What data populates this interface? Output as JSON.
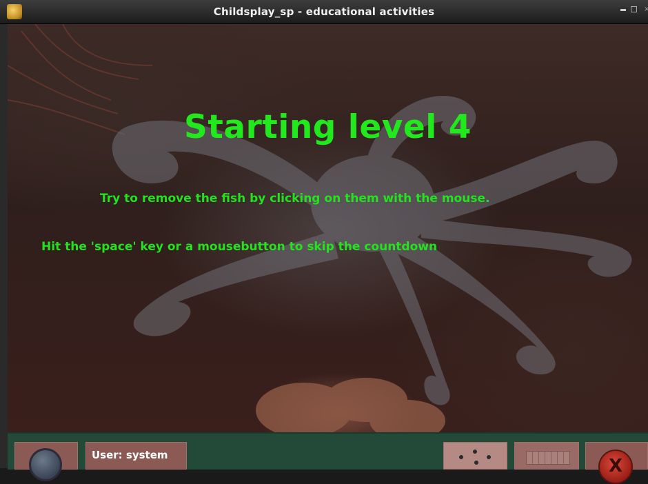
{
  "window": {
    "title": "Childsplay_sp - educational activities",
    "controls": {
      "minimize": "–",
      "maximize": "□",
      "close": "×"
    }
  },
  "game": {
    "level_title": "Starting level 4",
    "instruction": "Try to remove the fish by clicking on them with the mouse.",
    "skip_hint": "Hit the 'space' key or a mousebutton to skip the countdown"
  },
  "bottom_bar": {
    "user_label": "User: system",
    "quit_symbol": "X"
  },
  "icons": [
    "app-icon",
    "help-icon",
    "dice-icon",
    "keyboard-icon",
    "quit-icon"
  ],
  "colors": {
    "message_text": "#22e81e",
    "bottom_bar": "#234a39",
    "tile": "#8c5a55"
  }
}
